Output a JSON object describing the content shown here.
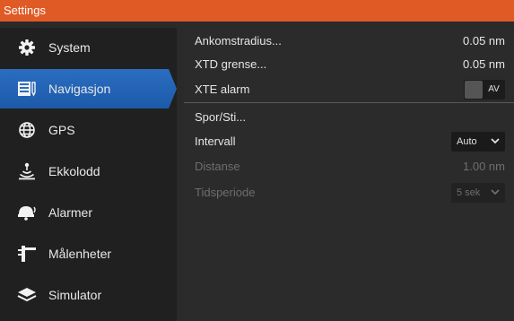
{
  "window": {
    "title": "Settings",
    "accent_color": "#e05a26",
    "selection_color": "#2a6dc1"
  },
  "sidebar": {
    "items": [
      {
        "label": "System",
        "icon": "gear-icon",
        "active": false
      },
      {
        "label": "Navigasjon",
        "icon": "chart-book-icon",
        "active": true
      },
      {
        "label": "GPS",
        "icon": "globe-icon",
        "active": false
      },
      {
        "label": "Ekkolodd",
        "icon": "sonar-icon",
        "active": false
      },
      {
        "label": "Alarmer",
        "icon": "alarm-bell-icon",
        "active": false
      },
      {
        "label": "Målenheter",
        "icon": "ruler-icon",
        "active": false
      },
      {
        "label": "Simulator",
        "icon": "layers-icon",
        "active": false
      }
    ]
  },
  "settings": {
    "arrival_radius": {
      "label": "Ankomstradius...",
      "value": "0.05 nm"
    },
    "xtd_limit": {
      "label": "XTD grense...",
      "value": "0.05 nm"
    },
    "xte_alarm": {
      "label": "XTE alarm",
      "toggle_label": "AV",
      "on": false
    },
    "tracks": {
      "label": "Spor/Sti..."
    },
    "interval": {
      "label": "Intervall",
      "value": "Auto"
    },
    "distance": {
      "label": "Distanse",
      "value": "1.00 nm",
      "enabled": false
    },
    "time_period": {
      "label": "Tidsperiode",
      "value": "5 sek",
      "enabled": false
    }
  }
}
